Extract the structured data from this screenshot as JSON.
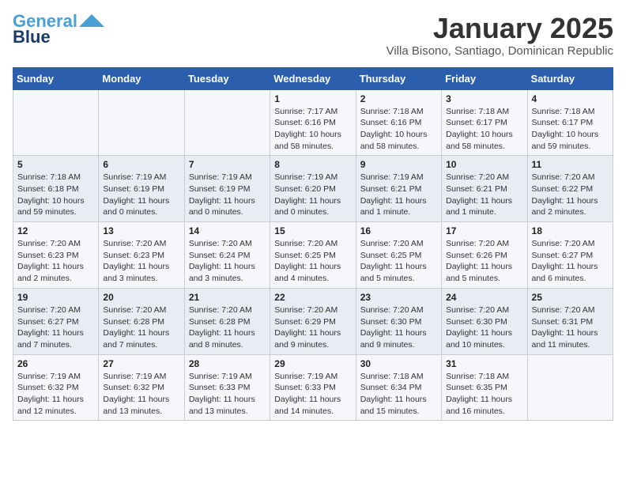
{
  "header": {
    "logo_line1": "General",
    "logo_line2": "Blue",
    "month": "January 2025",
    "location": "Villa Bisono, Santiago, Dominican Republic"
  },
  "weekdays": [
    "Sunday",
    "Monday",
    "Tuesday",
    "Wednesday",
    "Thursday",
    "Friday",
    "Saturday"
  ],
  "weeks": [
    [
      {
        "day": "",
        "info": ""
      },
      {
        "day": "",
        "info": ""
      },
      {
        "day": "",
        "info": ""
      },
      {
        "day": "1",
        "info": "Sunrise: 7:17 AM\nSunset: 6:16 PM\nDaylight: 10 hours\nand 58 minutes."
      },
      {
        "day": "2",
        "info": "Sunrise: 7:18 AM\nSunset: 6:16 PM\nDaylight: 10 hours\nand 58 minutes."
      },
      {
        "day": "3",
        "info": "Sunrise: 7:18 AM\nSunset: 6:17 PM\nDaylight: 10 hours\nand 58 minutes."
      },
      {
        "day": "4",
        "info": "Sunrise: 7:18 AM\nSunset: 6:17 PM\nDaylight: 10 hours\nand 59 minutes."
      }
    ],
    [
      {
        "day": "5",
        "info": "Sunrise: 7:18 AM\nSunset: 6:18 PM\nDaylight: 10 hours\nand 59 minutes."
      },
      {
        "day": "6",
        "info": "Sunrise: 7:19 AM\nSunset: 6:19 PM\nDaylight: 11 hours\nand 0 minutes."
      },
      {
        "day": "7",
        "info": "Sunrise: 7:19 AM\nSunset: 6:19 PM\nDaylight: 11 hours\nand 0 minutes."
      },
      {
        "day": "8",
        "info": "Sunrise: 7:19 AM\nSunset: 6:20 PM\nDaylight: 11 hours\nand 0 minutes."
      },
      {
        "day": "9",
        "info": "Sunrise: 7:19 AM\nSunset: 6:21 PM\nDaylight: 11 hours\nand 1 minute."
      },
      {
        "day": "10",
        "info": "Sunrise: 7:20 AM\nSunset: 6:21 PM\nDaylight: 11 hours\nand 1 minute."
      },
      {
        "day": "11",
        "info": "Sunrise: 7:20 AM\nSunset: 6:22 PM\nDaylight: 11 hours\nand 2 minutes."
      }
    ],
    [
      {
        "day": "12",
        "info": "Sunrise: 7:20 AM\nSunset: 6:23 PM\nDaylight: 11 hours\nand 2 minutes."
      },
      {
        "day": "13",
        "info": "Sunrise: 7:20 AM\nSunset: 6:23 PM\nDaylight: 11 hours\nand 3 minutes."
      },
      {
        "day": "14",
        "info": "Sunrise: 7:20 AM\nSunset: 6:24 PM\nDaylight: 11 hours\nand 3 minutes."
      },
      {
        "day": "15",
        "info": "Sunrise: 7:20 AM\nSunset: 6:25 PM\nDaylight: 11 hours\nand 4 minutes."
      },
      {
        "day": "16",
        "info": "Sunrise: 7:20 AM\nSunset: 6:25 PM\nDaylight: 11 hours\nand 5 minutes."
      },
      {
        "day": "17",
        "info": "Sunrise: 7:20 AM\nSunset: 6:26 PM\nDaylight: 11 hours\nand 5 minutes."
      },
      {
        "day": "18",
        "info": "Sunrise: 7:20 AM\nSunset: 6:27 PM\nDaylight: 11 hours\nand 6 minutes."
      }
    ],
    [
      {
        "day": "19",
        "info": "Sunrise: 7:20 AM\nSunset: 6:27 PM\nDaylight: 11 hours\nand 7 minutes."
      },
      {
        "day": "20",
        "info": "Sunrise: 7:20 AM\nSunset: 6:28 PM\nDaylight: 11 hours\nand 7 minutes."
      },
      {
        "day": "21",
        "info": "Sunrise: 7:20 AM\nSunset: 6:28 PM\nDaylight: 11 hours\nand 8 minutes."
      },
      {
        "day": "22",
        "info": "Sunrise: 7:20 AM\nSunset: 6:29 PM\nDaylight: 11 hours\nand 9 minutes."
      },
      {
        "day": "23",
        "info": "Sunrise: 7:20 AM\nSunset: 6:30 PM\nDaylight: 11 hours\nand 9 minutes."
      },
      {
        "day": "24",
        "info": "Sunrise: 7:20 AM\nSunset: 6:30 PM\nDaylight: 11 hours\nand 10 minutes."
      },
      {
        "day": "25",
        "info": "Sunrise: 7:20 AM\nSunset: 6:31 PM\nDaylight: 11 hours\nand 11 minutes."
      }
    ],
    [
      {
        "day": "26",
        "info": "Sunrise: 7:19 AM\nSunset: 6:32 PM\nDaylight: 11 hours\nand 12 minutes."
      },
      {
        "day": "27",
        "info": "Sunrise: 7:19 AM\nSunset: 6:32 PM\nDaylight: 11 hours\nand 13 minutes."
      },
      {
        "day": "28",
        "info": "Sunrise: 7:19 AM\nSunset: 6:33 PM\nDaylight: 11 hours\nand 13 minutes."
      },
      {
        "day": "29",
        "info": "Sunrise: 7:19 AM\nSunset: 6:33 PM\nDaylight: 11 hours\nand 14 minutes."
      },
      {
        "day": "30",
        "info": "Sunrise: 7:18 AM\nSunset: 6:34 PM\nDaylight: 11 hours\nand 15 minutes."
      },
      {
        "day": "31",
        "info": "Sunrise: 7:18 AM\nSunset: 6:35 PM\nDaylight: 11 hours\nand 16 minutes."
      },
      {
        "day": "",
        "info": ""
      }
    ]
  ]
}
